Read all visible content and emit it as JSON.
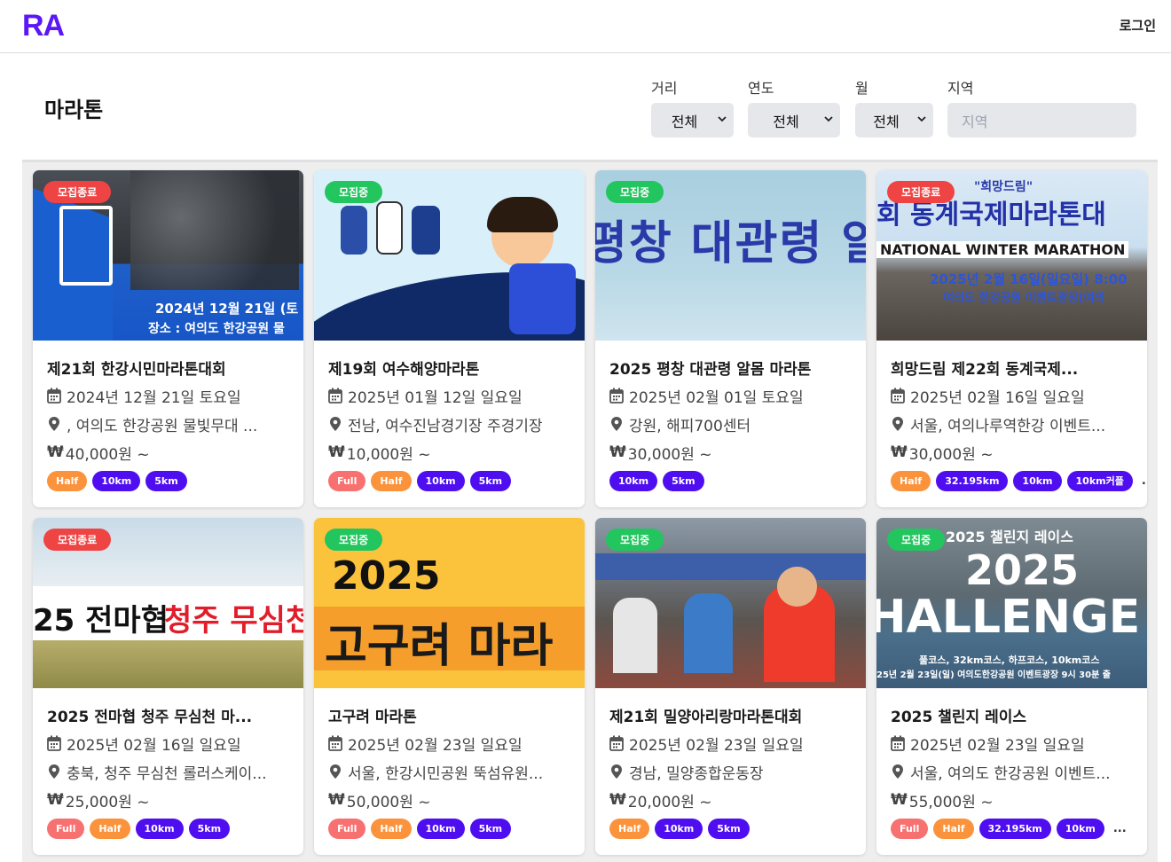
{
  "app": {
    "logo": "RA",
    "login": "로그인"
  },
  "page": {
    "title": "마라톤"
  },
  "filters": {
    "distance": {
      "label": "거리",
      "value": "전체"
    },
    "year": {
      "label": "연도",
      "value": "전체"
    },
    "month": {
      "label": "월",
      "value": "전체"
    },
    "region": {
      "label": "지역",
      "placeholder": "지역"
    }
  },
  "cards": [
    {
      "status": "모집종료",
      "title": "제21회 한강시민마라톤대회",
      "date": "2024년 12월 21일 토요일",
      "location": ", 여의도 한강공원 물빛무대 ...",
      "price": "40,000원 ~",
      "tags": [
        "Half",
        "10km",
        "5km"
      ],
      "more": "",
      "thumb_text": [
        "2024년 12월 21일 (토",
        "장소 : 여의도 한강공원 물"
      ]
    },
    {
      "status": "모집중",
      "title": "제19회 여수해양마라톤",
      "date": "2025년 01월 12일 일요일",
      "location": "전남, 여수진남경기장 주경기장",
      "price": "10,000원 ~",
      "tags": [
        "Full",
        "Half",
        "10km",
        "5km"
      ],
      "more": "",
      "thumb_text": []
    },
    {
      "status": "모집중",
      "title": "2025 평창 대관령 알몸 마라톤",
      "date": "2025년 02월 01일 토요일",
      "location": "강원, 해피700센터",
      "price": "30,000원 ~",
      "tags": [
        "10km",
        "5km"
      ],
      "more": "",
      "thumb_text": [
        "평창 대관령 알몸"
      ]
    },
    {
      "status": "모집종료",
      "title": "희망드림 제22회 동계국제...",
      "date": "2025년 02월 16일 일요일",
      "location": "서울, 여의나루역한강 이벤트...",
      "price": "30,000원 ~",
      "tags": [
        "Half",
        "32.195km",
        "10km",
        "10km커플"
      ],
      "more": "...",
      "thumb_text": [
        "\"희망드림\"",
        "회 동계국제마라톤대",
        "NATIONAL WINTER MARATHON",
        "2025년 2월 16일(일요일) 8:00",
        "여의도 한강공원 이벤트광장(여의"
      ]
    },
    {
      "status": "모집종료",
      "title": "2025 전마협 청주 무심천 마...",
      "date": "2025년 02월 16일 일요일",
      "location": "충북, 청주 무심천 롤러스케이...",
      "price": "25,000원 ~",
      "tags": [
        "Full",
        "Half",
        "10km",
        "5km"
      ],
      "more": "",
      "thumb_text": [
        "25 전마협",
        "청주 무심천 투"
      ]
    },
    {
      "status": "모집중",
      "title": "고구려 마라톤",
      "date": "2025년 02월 23일 일요일",
      "location": "서울, 한강시민공원 뚝섬유원...",
      "price": "50,000원 ~",
      "tags": [
        "Full",
        "Half",
        "10km",
        "5km"
      ],
      "more": "",
      "thumb_text": [
        "2025",
        "고구려 마라"
      ]
    },
    {
      "status": "모집중",
      "title": "제21회 밀양아리랑마라톤대회",
      "date": "2025년 02월 23일 일요일",
      "location": "경남, 밀양종합운동장",
      "price": "20,000원 ~",
      "tags": [
        "Half",
        "10km",
        "5km"
      ],
      "more": "",
      "thumb_text": []
    },
    {
      "status": "모집중",
      "title": "2025 챌린지 레이스",
      "date": "2025년 02월 23일 일요일",
      "location": "서울, 여의도 한강공원 이벤트...",
      "price": "55,000원 ~",
      "tags": [
        "Full",
        "Half",
        "32.195km",
        "10km"
      ],
      "more": "...",
      "thumb_text": [
        "2025 챌린지 레이스",
        "2025",
        "HALLENGE RAC",
        "풀코스, 32km코스, 하프코스, 10km코스",
        "25년 2월 23일(일) 여의도한강공원 이벤트광장 9시 30분 출"
      ]
    }
  ],
  "colors": {
    "brand": "#5b17f5",
    "closed": "#ef4444",
    "open": "#22c55e",
    "full": "#f87171",
    "half": "#fb923c",
    "km": "#4f0ef0"
  }
}
